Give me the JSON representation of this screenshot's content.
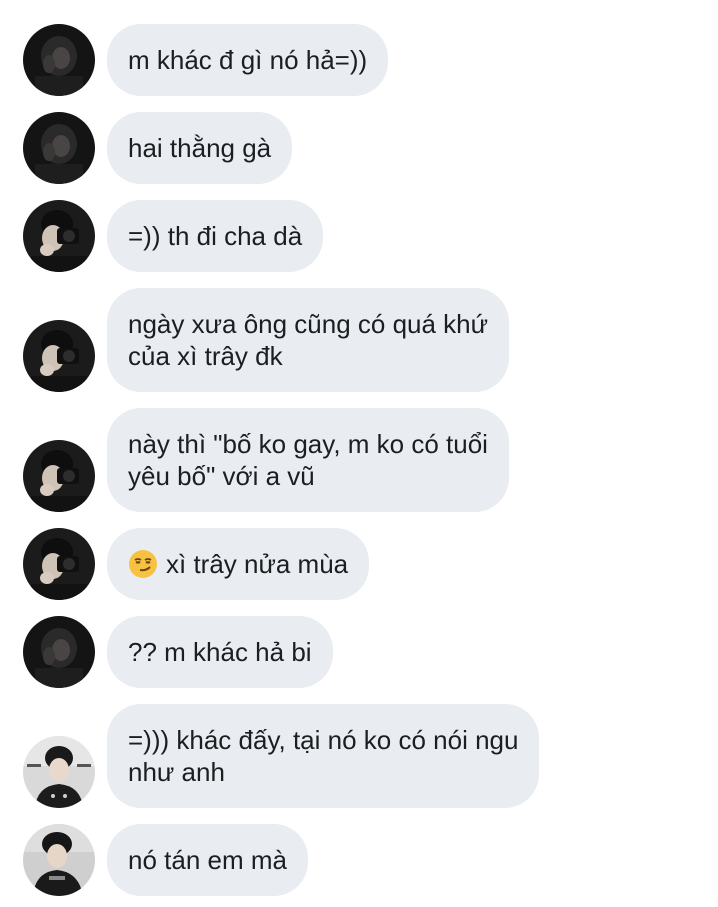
{
  "messages": [
    {
      "avatar": "dark-hooded-avatar",
      "text": "m khác đ gì nó hả=))"
    },
    {
      "avatar": "dark-hooded-avatar",
      "text": "hai thằng gà"
    },
    {
      "avatar": "camera-photographer-avatar",
      "text": "=)) th đi cha dà"
    },
    {
      "avatar": "camera-photographer-avatar",
      "text": "ngày xưa ông cũng có quá khứ\ncủa xì trây đk"
    },
    {
      "avatar": "camera-photographer-avatar",
      "text": "này thì \"bố ko gay, m ko có tuổi\nyêu bố\" với a vũ"
    },
    {
      "avatar": "camera-photographer-avatar",
      "emoji": "smirking-face-emoji",
      "text": "xì trây nửa mùa"
    },
    {
      "avatar": "dark-hooded-avatar",
      "text": "?? m khác hả bi"
    },
    {
      "avatar": "event-photo-avatar",
      "text": "=))) khác đấy, tại nó ko có nói ngu\nnhư anh"
    },
    {
      "avatar": "event-photo-avatar",
      "text": "nó tán em mà"
    }
  ],
  "colors": {
    "bubble": "#e9ecf0",
    "text": "#1c1e21",
    "background": "#ffffff"
  }
}
